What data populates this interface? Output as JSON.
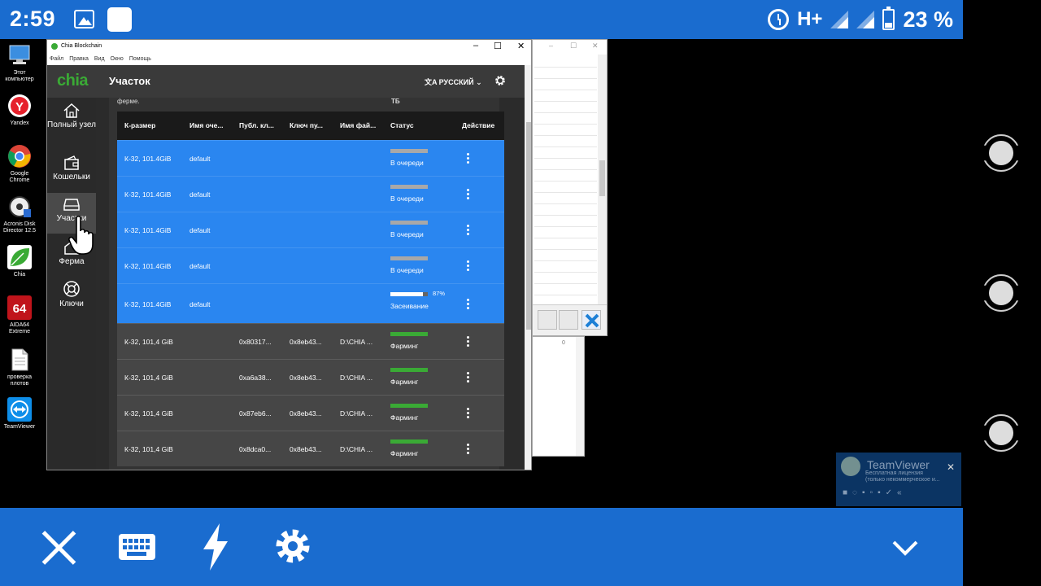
{
  "status_bar": {
    "time": "2:59",
    "network": "H+",
    "battery": "23 %"
  },
  "desktop_icons": [
    {
      "label": "Этот компьютер",
      "icon": "computer-icon"
    },
    {
      "label": "Yandex",
      "icon": "yandex-icon"
    },
    {
      "label": "Google Chrome",
      "icon": "chrome-icon"
    },
    {
      "label": "Acronis Disk Director 12.5",
      "icon": "acronis-icon"
    },
    {
      "label": "Chia",
      "icon": "chia-leaf-icon"
    },
    {
      "label": "AIDA64 Extreme",
      "icon": "aida64-icon"
    },
    {
      "label": "проверка плотов",
      "icon": "document-icon"
    },
    {
      "label": "TeamViewer",
      "icon": "teamviewer-icon"
    }
  ],
  "chia_window": {
    "window_title": "Chia Blockchain",
    "menu": [
      "Файл",
      "Правка",
      "Вид",
      "Окно",
      "Помощь"
    ],
    "logo": "chia",
    "page_title": "Участок",
    "language": "РУССКИЙ",
    "sidebar": [
      {
        "label": "Полный узел",
        "icon": "home-icon"
      },
      {
        "label": "Кошельки",
        "icon": "wallet-icon"
      },
      {
        "label": "Участки",
        "icon": "storage-icon",
        "active": true
      },
      {
        "label": "Ферма",
        "icon": "farm-icon"
      },
      {
        "label": "Ключи",
        "icon": "lifebuoy-icon"
      }
    ],
    "hint_left": "ферме.",
    "hint_right": "ТБ",
    "columns": [
      "К-размер",
      "Имя оче...",
      "Публ. кл...",
      "Ключ пу...",
      "Имя фай...",
      "Статус",
      "Действие"
    ],
    "rows": [
      {
        "size": "К-32, 101.4GiB",
        "queue": "default",
        "pub": "",
        "key": "",
        "file": "",
        "status": "В очереди",
        "kind": "queued",
        "progress": 0
      },
      {
        "size": "К-32, 101.4GiB",
        "queue": "default",
        "pub": "",
        "key": "",
        "file": "",
        "status": "В очереди",
        "kind": "queued",
        "progress": 0
      },
      {
        "size": "К-32, 101.4GiB",
        "queue": "default",
        "pub": "",
        "key": "",
        "file": "",
        "status": "В очереди",
        "kind": "queued",
        "progress": 0
      },
      {
        "size": "К-32, 101.4GiB",
        "queue": "default",
        "pub": "",
        "key": "",
        "file": "",
        "status": "В очереди",
        "kind": "queued",
        "progress": 0
      },
      {
        "size": "К-32, 101.4GiB",
        "queue": "default",
        "pub": "",
        "key": "",
        "file": "",
        "status": "Засеивание",
        "kind": "seeding",
        "progress": 87,
        "pct": "87%"
      },
      {
        "size": "К-32, 101,4 GiB",
        "queue": "",
        "pub": "0x80317...",
        "key": "0x8eb43...",
        "file": "D:\\CHIA ...",
        "status": "Фарминг",
        "kind": "farm",
        "progress": 100
      },
      {
        "size": "К-32, 101,4 GiB",
        "queue": "",
        "pub": "0xa6a38...",
        "key": "0x8eb43...",
        "file": "D:\\CHIA ...",
        "status": "Фарминг",
        "kind": "farm",
        "progress": 100
      },
      {
        "size": "К-32, 101,4 GiB",
        "queue": "",
        "pub": "0x87eb6...",
        "key": "0x8eb43...",
        "file": "D:\\CHIA ...",
        "status": "Фарминг",
        "kind": "farm",
        "progress": 100
      },
      {
        "size": "К-32, 101,4 GiB",
        "queue": "",
        "pub": "0x8dca0...",
        "key": "0x8eb43...",
        "file": "D:\\CHIA ...",
        "status": "Фарминг",
        "kind": "farm",
        "progress": 100
      }
    ]
  },
  "bg_window": {
    "value": "0"
  },
  "teamviewer_popup": {
    "name": "TeamViewer",
    "line1": "Бесплатная лицензия",
    "line2": "(только некоммерческое и..."
  },
  "colors": {
    "android_blue": "#1a6ccf",
    "chia_green": "#3aaa35",
    "row_blue": "#2a86f0",
    "farm_row": "#464646"
  }
}
